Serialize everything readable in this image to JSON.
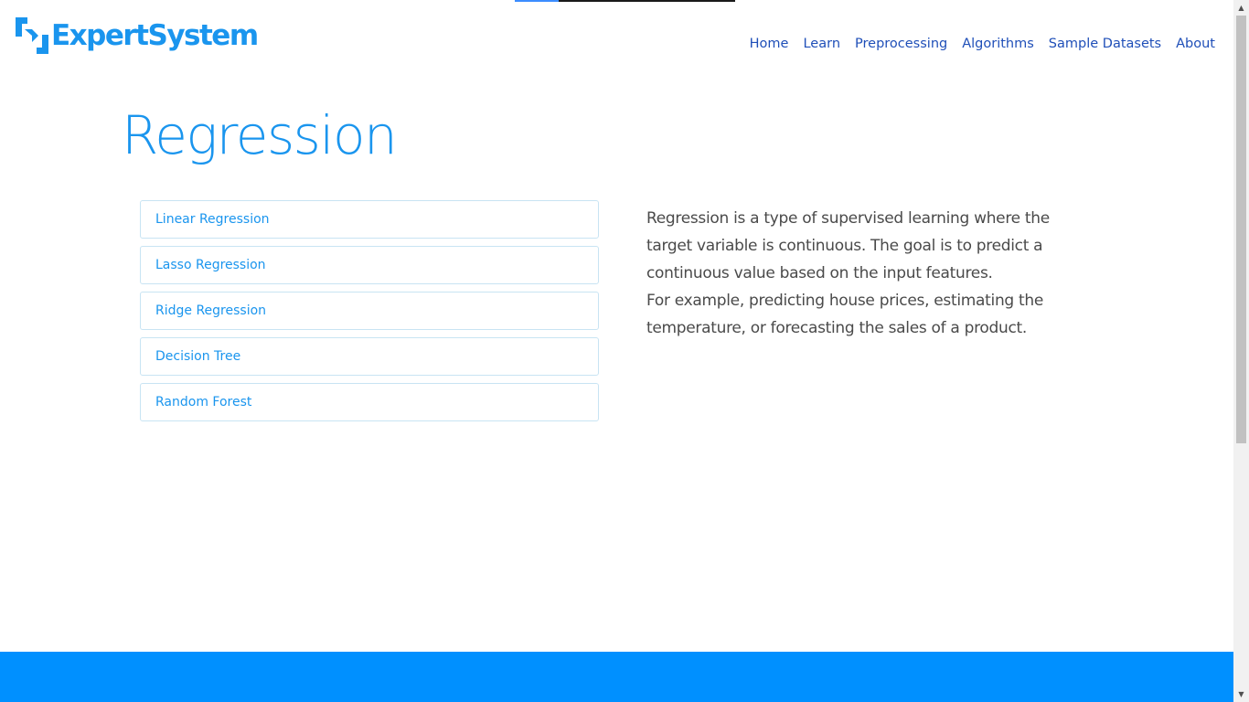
{
  "navbar": {
    "brand": "ExpertSystem",
    "links": [
      "Home",
      "Learn",
      "Preprocessing",
      "Algorithms",
      "Sample Datasets",
      "About"
    ]
  },
  "page": {
    "title": "Regression"
  },
  "algorithms": [
    "Linear Regression",
    "Lasso Regression",
    "Ridge Regression",
    "Decision Tree",
    "Random Forest"
  ],
  "description": {
    "paragraph_1": "Regression is a type of supervised learning where the target variable is continuous. The goal is to predict a continuous value based on the input features.",
    "paragraph_2": "For example, predicting house prices, estimating the temperature, or forecasting the sales of a product."
  },
  "page_load_progress": 0.2,
  "colors": {
    "brand_blue": "#1a95ee",
    "nav_link": "#1f4fb8",
    "footer_blue": "#0090ff",
    "body_text": "#4a4a4a",
    "list_border": "#c8e4f3"
  },
  "icons": {
    "logo": "expertsystem-logo-icon",
    "scroll_up": "scroll-up-arrow-icon",
    "scroll_down": "scroll-down-arrow-icon"
  }
}
